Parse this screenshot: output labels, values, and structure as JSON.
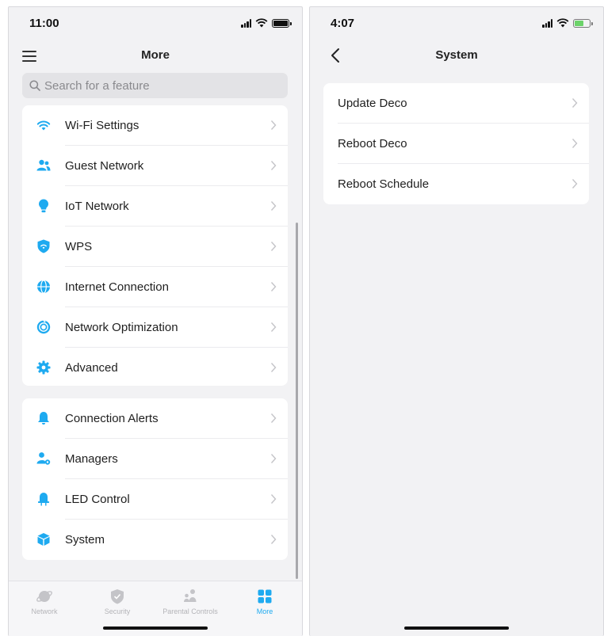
{
  "left_screen": {
    "status_time": "11:00",
    "title": "More",
    "search_placeholder": "Search for a feature",
    "group1": [
      {
        "label": "Wi-Fi Settings",
        "icon": "wifi-icon"
      },
      {
        "label": "Guest Network",
        "icon": "guest-users-icon"
      },
      {
        "label": "IoT Network",
        "icon": "bulb-icon"
      },
      {
        "label": "WPS",
        "icon": "wps-shield-icon"
      },
      {
        "label": "Internet Connection",
        "icon": "globe-icon"
      },
      {
        "label": "Network Optimization",
        "icon": "optimization-icon"
      },
      {
        "label": "Advanced",
        "icon": "gear-icon"
      }
    ],
    "group2": [
      {
        "label": "Connection Alerts",
        "icon": "bell-icon"
      },
      {
        "label": "Managers",
        "icon": "managers-icon"
      },
      {
        "label": "LED Control",
        "icon": "led-icon"
      },
      {
        "label": "System",
        "icon": "cube-icon"
      }
    ],
    "tabs": [
      {
        "label": "Network",
        "icon": "planet-icon",
        "active": false
      },
      {
        "label": "Security",
        "icon": "shield-icon",
        "active": false
      },
      {
        "label": "Parental Controls",
        "icon": "family-icon",
        "active": false
      },
      {
        "label": "More",
        "icon": "grid-icon",
        "active": true
      }
    ]
  },
  "right_screen": {
    "status_time": "4:07",
    "title": "System",
    "items": [
      {
        "label": "Update Deco"
      },
      {
        "label": "Reboot Deco"
      },
      {
        "label": "Reboot Schedule"
      }
    ]
  },
  "colors": {
    "accent": "#1eaaf0",
    "background": "#f2f2f4",
    "card": "#ffffff"
  }
}
